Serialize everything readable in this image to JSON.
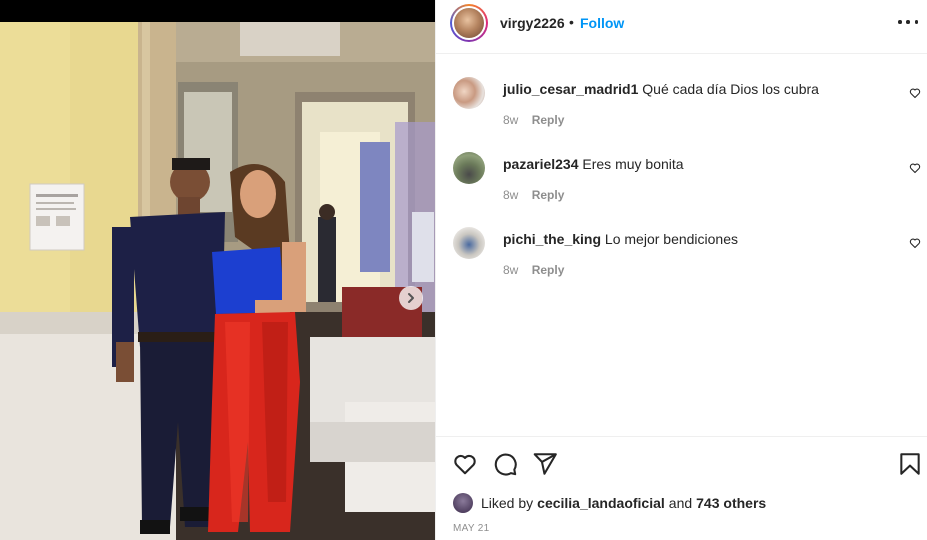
{
  "post": {
    "username": "virgy2226",
    "separator": "•",
    "follow_label": "Follow"
  },
  "comments": [
    {
      "username": "julio_cesar_madrid1",
      "text": "Qué cada día Dios los cubra",
      "age": "8w",
      "reply_label": "Reply"
    },
    {
      "username": "pazariel234",
      "text": "Eres muy bonita",
      "age": "8w",
      "reply_label": "Reply"
    },
    {
      "username": "pichi_the_king",
      "text": "Lo mejor bendiciones",
      "age": "8w",
      "reply_label": "Reply"
    }
  ],
  "likes": {
    "prefix": "Liked by",
    "user": "cecilia_landaoficial",
    "joiner": "and",
    "others": "743 others"
  },
  "date": "MAY 21",
  "icons": {
    "like": "heart-icon",
    "comment": "comment-icon",
    "share": "share-icon",
    "save": "bookmark-icon",
    "more": "more-options-icon",
    "next": "chevron-right-icon"
  }
}
